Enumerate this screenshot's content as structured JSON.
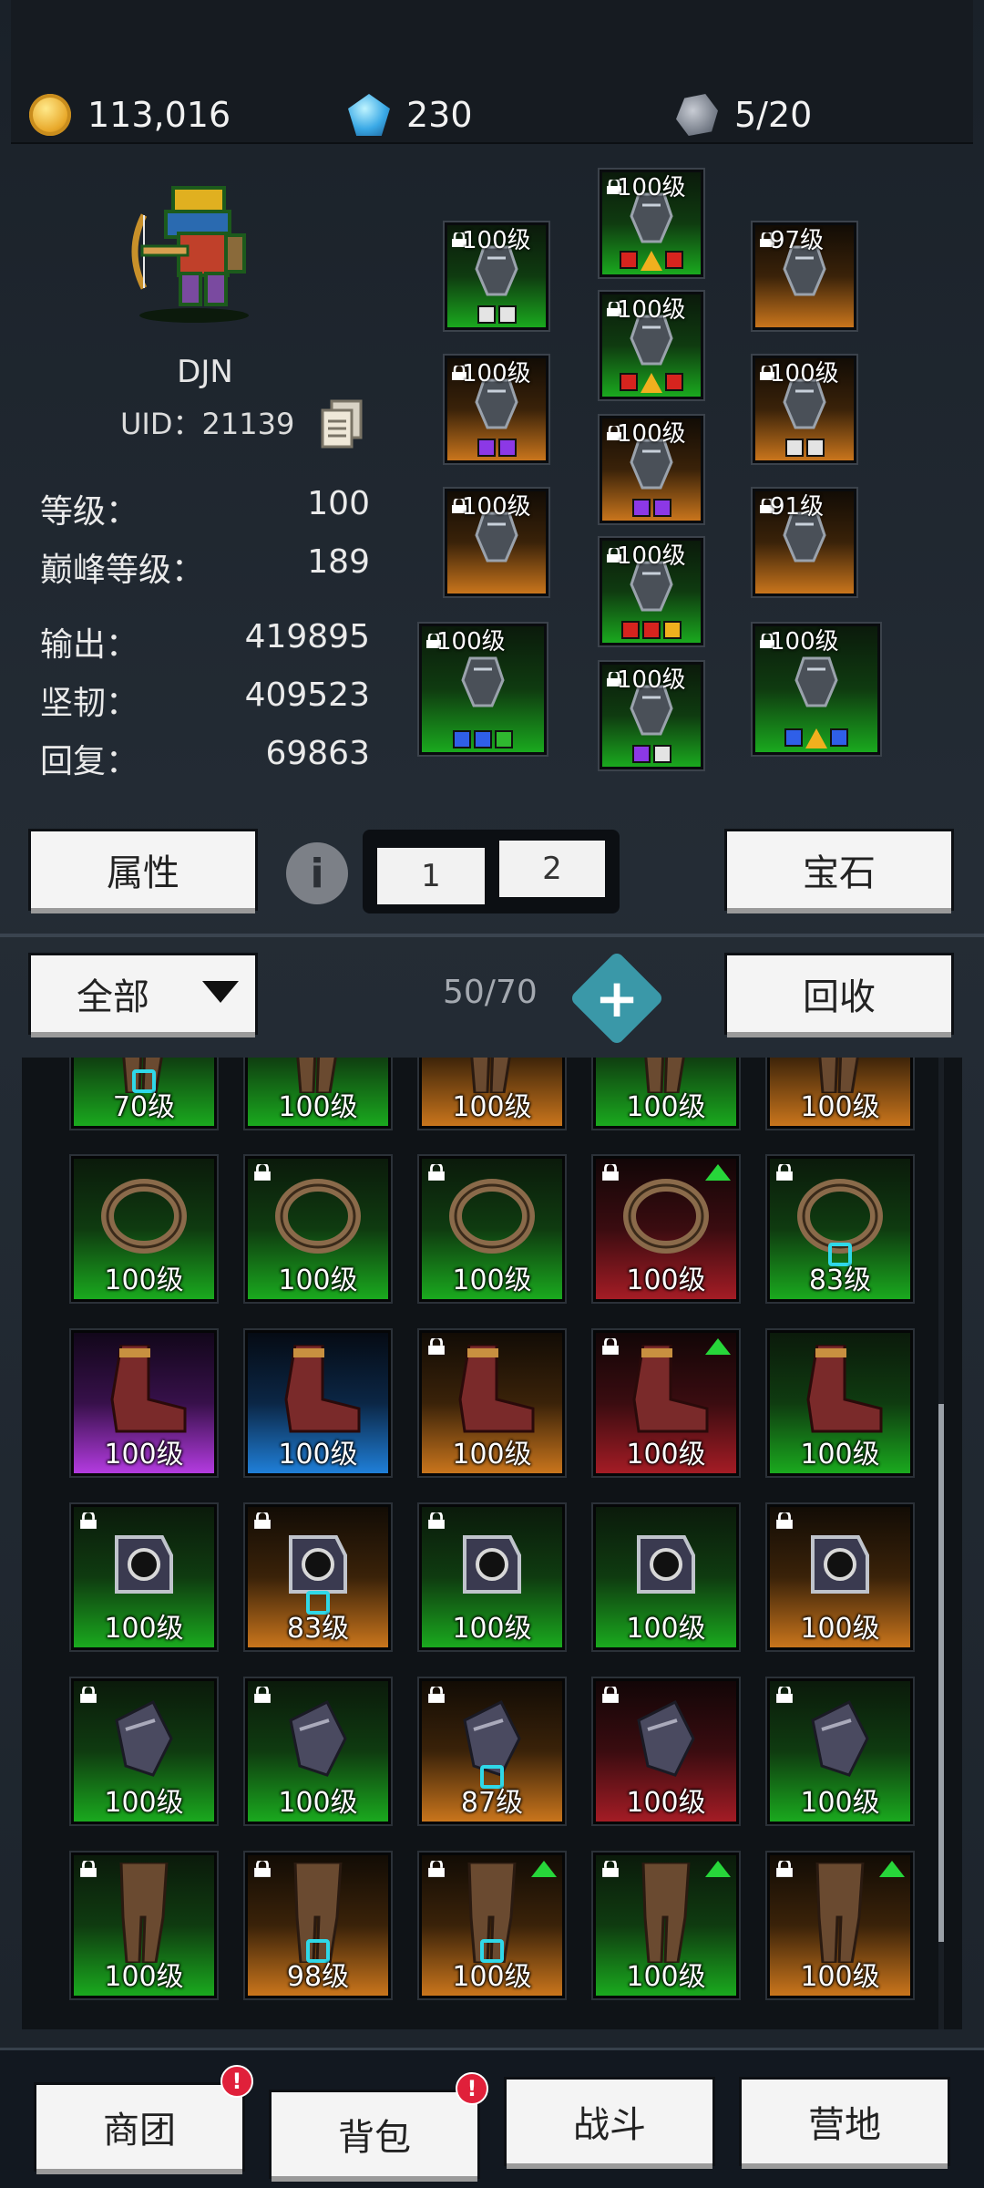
{
  "resources": {
    "gold": "113,016",
    "gems": "230",
    "ore": "5/20"
  },
  "character": {
    "name": "DJN",
    "uid": "UID：21139",
    "stats": [
      {
        "label": "等级：",
        "value": "100"
      },
      {
        "label": "巅峰等级：",
        "value": "189"
      },
      {
        "label": "输出：",
        "value": "419895"
      },
      {
        "label": "坚韧：",
        "value": "409523"
      },
      {
        "label": "回复：",
        "value": "69863"
      }
    ]
  },
  "equipment": [
    {
      "level": "100级",
      "quality": "green",
      "gems": [
        "white",
        "white"
      ]
    },
    {
      "level": "100级",
      "quality": "orange",
      "gems": [
        "purple",
        "purple"
      ]
    },
    {
      "level": "100级",
      "quality": "orange",
      "gems": []
    },
    {
      "level": "100级",
      "quality": "green",
      "gems": [
        "blue",
        "blue",
        "green"
      ]
    },
    {
      "level": "100级",
      "quality": "green",
      "gems": [
        "red",
        "tri",
        "red"
      ]
    },
    {
      "level": "100级",
      "quality": "green",
      "gems": [
        "red",
        "tri",
        "red"
      ]
    },
    {
      "level": "100级",
      "quality": "orange",
      "gems": [
        "purple",
        "purple"
      ]
    },
    {
      "level": "100级",
      "quality": "green",
      "gems": [
        "red",
        "red",
        "yellow"
      ]
    },
    {
      "level": "100级",
      "quality": "green",
      "gems": [
        "purple",
        "white"
      ]
    },
    {
      "level": "97级",
      "quality": "orange",
      "gems": []
    },
    {
      "level": "100级",
      "quality": "orange",
      "gems": [
        "white",
        "white"
      ]
    },
    {
      "level": "91级",
      "quality": "orange",
      "gems": []
    },
    {
      "level": "100级",
      "quality": "green",
      "gems": [
        "blue",
        "tri",
        "blue"
      ]
    }
  ],
  "tabs": {
    "attributes": "属性",
    "info": "i",
    "page1": "1",
    "page2": "2",
    "gems": "宝石"
  },
  "inventory": {
    "filter": "全部",
    "capacity": "50/70",
    "recycle": "回收",
    "items": [
      {
        "level": "70级",
        "quality": "green",
        "lock": false,
        "up": false,
        "gem": true
      },
      {
        "level": "100级",
        "quality": "green",
        "lock": false,
        "up": false,
        "gem": false
      },
      {
        "level": "100级",
        "quality": "orange",
        "lock": false,
        "up": false,
        "gem": false
      },
      {
        "level": "100级",
        "quality": "green",
        "lock": false,
        "up": false,
        "gem": false
      },
      {
        "level": "100级",
        "quality": "orange",
        "lock": false,
        "up": false,
        "gem": false
      },
      {
        "level": "100级",
        "quality": "green",
        "lock": false,
        "up": false,
        "gem": false
      },
      {
        "level": "100级",
        "quality": "green",
        "lock": true,
        "up": false,
        "gem": false
      },
      {
        "level": "100级",
        "quality": "green",
        "lock": true,
        "up": false,
        "gem": false
      },
      {
        "level": "100级",
        "quality": "red",
        "lock": true,
        "up": true,
        "gem": false
      },
      {
        "level": "83级",
        "quality": "green",
        "lock": true,
        "up": false,
        "gem": true
      },
      {
        "level": "100级",
        "quality": "purple",
        "lock": false,
        "up": false,
        "gem": false
      },
      {
        "level": "100级",
        "quality": "blue",
        "lock": false,
        "up": false,
        "gem": false
      },
      {
        "level": "100级",
        "quality": "orange",
        "lock": true,
        "up": false,
        "gem": false
      },
      {
        "level": "100级",
        "quality": "red",
        "lock": true,
        "up": true,
        "gem": false
      },
      {
        "level": "100级",
        "quality": "green",
        "lock": false,
        "up": false,
        "gem": false
      },
      {
        "level": "100级",
        "quality": "green",
        "lock": true,
        "up": false,
        "gem": false
      },
      {
        "level": "83级",
        "quality": "orange",
        "lock": true,
        "up": false,
        "gem": true
      },
      {
        "level": "100级",
        "quality": "green",
        "lock": true,
        "up": false,
        "gem": false
      },
      {
        "level": "100级",
        "quality": "green",
        "lock": false,
        "up": false,
        "gem": false
      },
      {
        "level": "100级",
        "quality": "orange",
        "lock": true,
        "up": false,
        "gem": false
      },
      {
        "level": "100级",
        "quality": "green",
        "lock": true,
        "up": false,
        "gem": false
      },
      {
        "level": "100级",
        "quality": "green",
        "lock": true,
        "up": false,
        "gem": false
      },
      {
        "level": "87级",
        "quality": "orange",
        "lock": true,
        "up": false,
        "gem": true
      },
      {
        "level": "100级",
        "quality": "red",
        "lock": true,
        "up": false,
        "gem": false
      },
      {
        "level": "100级",
        "quality": "green",
        "lock": true,
        "up": false,
        "gem": false
      },
      {
        "level": "100级",
        "quality": "green",
        "lock": true,
        "up": false,
        "gem": false
      },
      {
        "level": "98级",
        "quality": "orange",
        "lock": true,
        "up": false,
        "gem": true
      },
      {
        "level": "100级",
        "quality": "orange",
        "lock": true,
        "up": true,
        "gem": true
      },
      {
        "level": "100级",
        "quality": "green",
        "lock": true,
        "up": true,
        "gem": false
      },
      {
        "level": "100级",
        "quality": "orange",
        "lock": true,
        "up": true,
        "gem": false
      }
    ]
  },
  "nav": {
    "guild": "商团",
    "bag": "背包",
    "battle": "战斗",
    "camp": "营地",
    "badge": "!"
  },
  "colors": {
    "accent": "#3a98a8",
    "badge": "#e0203a",
    "quality_green": "#1aa91e",
    "quality_orange": "#c9751c",
    "quality_red": "#a41c25",
    "quality_purple": "#b33be0",
    "quality_blue": "#1f7fd8"
  }
}
